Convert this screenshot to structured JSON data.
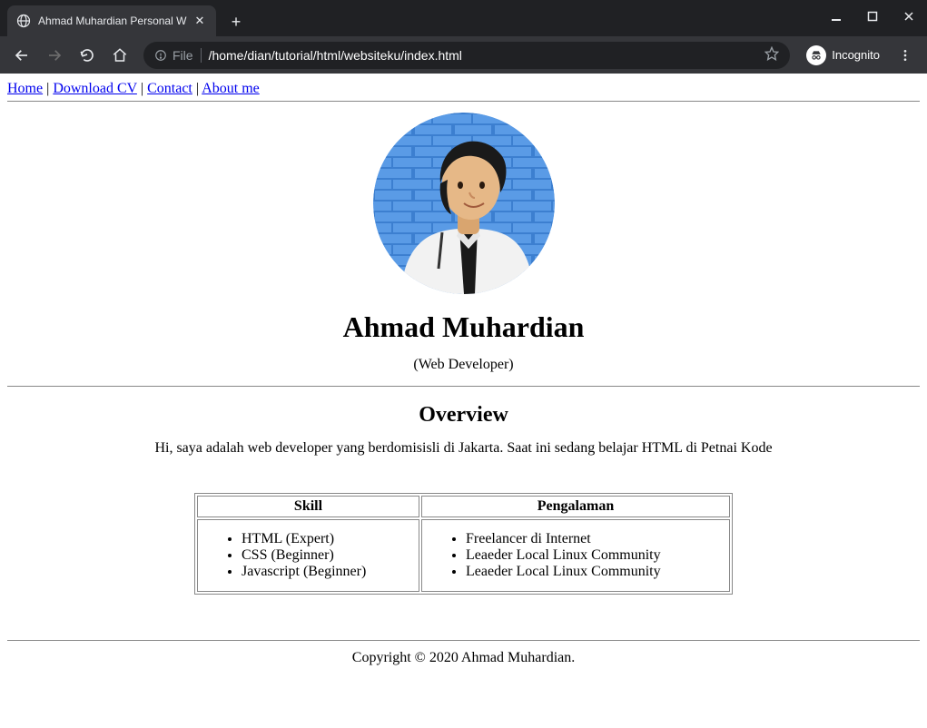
{
  "browser": {
    "tab_title": "Ahmad Muhardian Personal W",
    "url_scheme": "File",
    "url_path": "/home/dian/tutorial/html/websiteku/index.html",
    "incognito_label": "Incognito"
  },
  "nav": {
    "items": [
      {
        "label": "Home"
      },
      {
        "label": "Download CV"
      },
      {
        "label": "Contact"
      },
      {
        "label": "About me"
      }
    ],
    "separator": "|"
  },
  "profile": {
    "name": "Ahmad Muhardian",
    "subtitle": "(Web Developer)"
  },
  "overview": {
    "heading": "Overview",
    "text": "Hi, saya adalah web developer yang berdomisisli di Jakarta. Saat ini sedang belajar HTML di Petnai Kode"
  },
  "table": {
    "headers": [
      "Skill",
      "Pengalaman"
    ],
    "skills": [
      "HTML (Expert)",
      "CSS (Beginner)",
      "Javascript (Beginner)"
    ],
    "experiences": [
      "Freelancer di Internet",
      "Leaeder Local Linux Community",
      "Leaeder Local Linux Community"
    ]
  },
  "footer": {
    "text": "Copyright © 2020 Ahmad Muhardian."
  }
}
